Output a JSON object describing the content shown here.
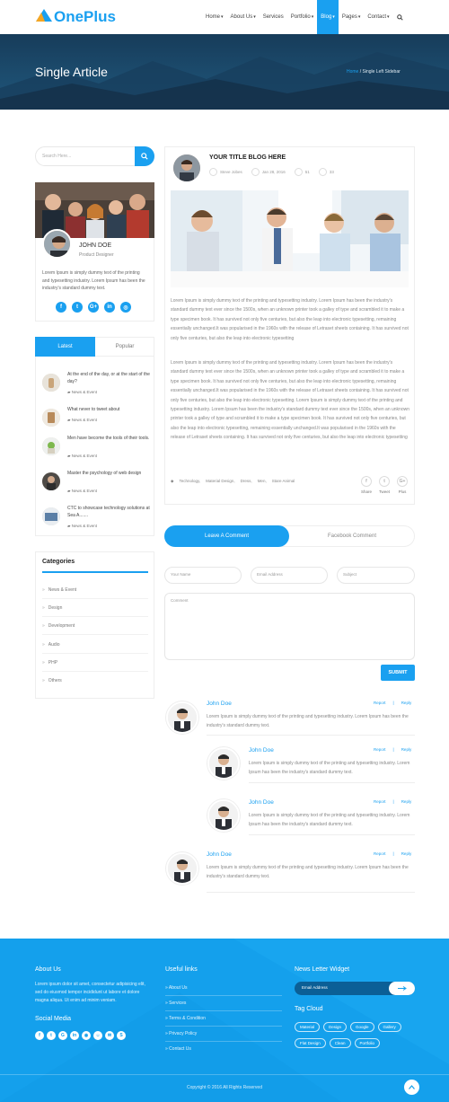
{
  "header": {
    "logo_text": "OnePlus",
    "nav": [
      {
        "label": "Home",
        "caret": "▾"
      },
      {
        "label": "About Us",
        "caret": "▾"
      },
      {
        "label": "Services",
        "caret": ""
      },
      {
        "label": "Portfolio",
        "caret": "▾"
      },
      {
        "label": "Blog",
        "caret": "▾",
        "active": true
      },
      {
        "label": "Pages",
        "caret": "▾"
      },
      {
        "label": "Contact",
        "caret": "▾"
      }
    ]
  },
  "banner": {
    "title": "Single Article",
    "breadcrumb_home": "Home",
    "breadcrumb_sep": "/",
    "breadcrumb_current": "Single Left Sidebar"
  },
  "sidebar": {
    "search_placeholder": "Search Here...",
    "profile": {
      "name": "JOHN DOE",
      "role": "Product Designer",
      "text": "Lorem Ipsum is simply dummy text of the printing and typesetting industry. Lorem Ipsum has been the industry's standard dummy text.",
      "social": [
        "f",
        "t",
        "G+",
        "in",
        "◎"
      ]
    },
    "tabs": {
      "latest": "Latest",
      "popular": "Popular"
    },
    "posts": [
      {
        "title": "At the end of the day, or at the start of the day?",
        "category": "News & Event"
      },
      {
        "title": "What never to tweet about",
        "category": "News & Event"
      },
      {
        "title": "Men have become the tools of their tools.",
        "category": "News & Event"
      },
      {
        "title": "Master the psychology of web design",
        "category": "News & Event"
      },
      {
        "title": "CTC to showcase technology solutions at Sea A.......",
        "category": "News & Event"
      }
    ],
    "categories_title": "Categories",
    "categories": [
      "News & Event",
      "Design",
      "Development",
      "Audio",
      "PHP",
      "Others"
    ]
  },
  "article": {
    "title": "YOUR TITLE BLOG HERE",
    "author": "Steve Jobes",
    "date": "Jan 28, 2016",
    "likes": "51",
    "comments": "33",
    "paragraph1": "Lorem Ipsum is simply dummy text of the printing and typesetting industry. Lorem Ipsum has been the industry's standard dummy text ever since the 1500s, when an unknown printer took a galley of type and scrambled it to make a type specimen book. It has survived not only five centuries, but also the leap into electronic typesetting, remaining essentially unchanged.It was popularised in the 1960s with the release of Letraset sheets containing. It has survived not only five centuries, but also the leap into electronic typesetting",
    "paragraph2": "Lorem Ipsum is simply dummy text of the printing and typesetting industry. Lorem Ipsum has been the industry's standard dummy text ever since the 1500s, when an unknown printer took a galley of type and scrambled it to make a type specimen book. It has survived not only five centuries, but also the leap into electronic typesetting, remaining essentially unchanged.It was popularised in the 1960s with the release of Letraset sheets containing. It has survived not only five centuries, but also the leap into electronic typesetting. Lorem Ipsum is simply dummy text of the printing and typesetting industry. Lorem Ipsum has been the industry's standard dummy text ever since the 1500s, when an unknown printer took a galley of type and scrambled it to make a type specimen book. It has survived not only five centuries, but also the leap into electronic typesetting, remaining essentially unchanged.It was popularised in the 1960s with the release of Letraset sheets containing. It has survived not only five centuries, but also the leap into electronic typesetting",
    "tags": [
      "Technology,",
      "Material Design,",
      "Dress,",
      "Men,",
      "Stare Animal"
    ],
    "share": [
      {
        "icon": "f",
        "label": "Share"
      },
      {
        "icon": "t",
        "label": "Tweet"
      },
      {
        "icon": "G+",
        "label": "Plus"
      }
    ]
  },
  "comment_form": {
    "tab_leave": "Leave A Comment",
    "tab_facebook": "Facebook Comment",
    "name_placeholder": "Your Name",
    "email_placeholder": "Email Address",
    "subject_placeholder": "Subject",
    "comment_placeholder": "Comment",
    "submit": "SUBMIT"
  },
  "comments": [
    {
      "name": "John Doe",
      "text": "Lorem Ipsum is simply dummy text of the printing and typesetting industry. Lorem Ipsum has been the industry's standard dummy text.",
      "report": "Report",
      "sep": "|",
      "reply": "Reply"
    },
    {
      "name": "John Doe",
      "text": "Lorem Ipsum is simply dummy text of the printing and typesetting industry. Lorem Ipsum has been the industry's standard dummy text.",
      "report": "Report",
      "sep": "|",
      "reply": "Reply"
    },
    {
      "name": "John Doe",
      "text": "Lorem Ipsum is simply dummy text of the printing and typesetting industry. Lorem Ipsum has been the industry's standard dummy text.",
      "report": "Report",
      "sep": "|",
      "reply": "Reply"
    },
    {
      "name": "John Doe",
      "text": "Lorem Ipsum is simply dummy text of the printing and typesetting industry. Lorem Ipsum has been the industry's standard dummy text.",
      "report": "Report",
      "sep": "|",
      "reply": "Reply"
    }
  ],
  "footer": {
    "about_title": "About Us",
    "about_text": "Lorem ipsum dolor sit amet, consectetur adipisicing elit, sed do eiusmod tempor incididunt ut labore et dolore magna aliqua. Ut enim ad minim veniam.",
    "social_title": "Social Media",
    "social": [
      "f",
      "t",
      "G",
      "in",
      "◉",
      "☺",
      "✉",
      "S"
    ],
    "links_title": "Useful links",
    "links": [
      "About Us",
      "Services",
      "Terms & Condition",
      "Privacy Policy",
      "Contact Us"
    ],
    "newsletter_title": "News Letter Widget",
    "newsletter_placeholder": "Email Address",
    "tagcloud_title": "Tag Cloud",
    "tags_row1": [
      "Material",
      "Design",
      "Google",
      "Gallery"
    ],
    "tags_row2": [
      "Flat Design",
      "Clean",
      "Portfolio"
    ],
    "copyright": "Copyright © 2016 All Rights Reserved"
  },
  "colors": {
    "accent": "#1aa0f0",
    "footer": "#14a0ec",
    "banner": "#1c4c6e"
  }
}
